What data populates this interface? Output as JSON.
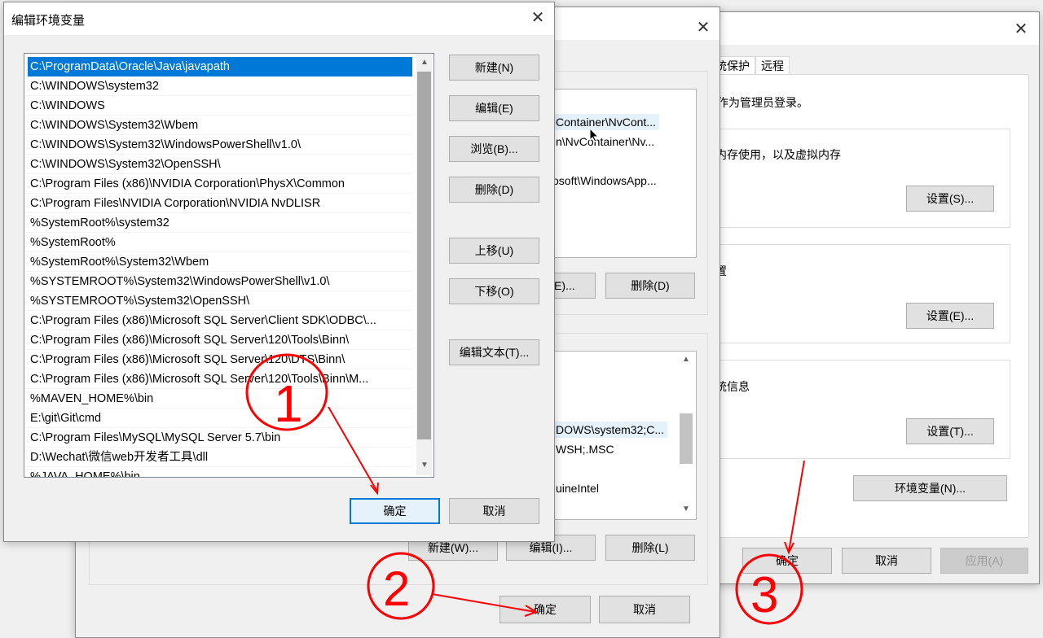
{
  "system_properties": {
    "tabs_partial": [
      "统保护",
      "远程"
    ],
    "admin_note": "作为管理员登录。",
    "perf_text": "内存使用，以及虚拟内存",
    "profile_text": "置",
    "startup_text": "统信息",
    "settings_labels": [
      "设置(S)...",
      "设置(E)...",
      "设置(T)..."
    ],
    "env_button": "环境变量(N)...",
    "ok": "确定",
    "cancel": "取消",
    "apply": "应用(A)"
  },
  "env_vars_window": {
    "user_vars_partial": [
      "Container\\NvCont...",
      "n\\NvContainer\\Nv...",
      "osoft\\WindowsApp..."
    ],
    "user_buttons": [
      "E)...",
      "删除(D)"
    ],
    "sys_vars_partial": [
      "DOWS\\system32;C...",
      "WSH;.MSC",
      "uineIntel"
    ],
    "sys_buttons": [
      "新建(W)...",
      "编辑(I)...",
      "删除(L)"
    ],
    "ok": "确定",
    "cancel": "取消"
  },
  "edit_dialog": {
    "title": "编辑环境变量",
    "entries": [
      "C:\\ProgramData\\Oracle\\Java\\javapath",
      "C:\\WINDOWS\\system32",
      "C:\\WINDOWS",
      "C:\\WINDOWS\\System32\\Wbem",
      "C:\\WINDOWS\\System32\\WindowsPowerShell\\v1.0\\",
      "C:\\WINDOWS\\System32\\OpenSSH\\",
      "C:\\Program Files (x86)\\NVIDIA Corporation\\PhysX\\Common",
      "C:\\Program Files\\NVIDIA Corporation\\NVIDIA NvDLISR",
      "%SystemRoot%\\system32",
      "%SystemRoot%",
      "%SystemRoot%\\System32\\Wbem",
      "%SYSTEMROOT%\\System32\\WindowsPowerShell\\v1.0\\",
      "%SYSTEMROOT%\\System32\\OpenSSH\\",
      "C:\\Program Files (x86)\\Microsoft SQL Server\\Client SDK\\ODBC\\...",
      "C:\\Program Files (x86)\\Microsoft SQL Server\\120\\Tools\\Binn\\",
      "C:\\Program Files (x86)\\Microsoft SQL Server\\120\\DTS\\Binn\\",
      "C:\\Program Files (x86)\\Microsoft SQL Server\\120\\Tools\\Binn\\M...",
      "%MAVEN_HOME%\\bin",
      "E:\\git\\Git\\cmd",
      "C:\\Program Files\\MySQL\\MySQL Server 5.7\\bin",
      "D:\\Wechat\\微信web开发者工具\\dll",
      "%JAVA_HOME%\\bin"
    ],
    "buttons": {
      "new": "新建(N)",
      "edit": "编辑(E)",
      "browse": "浏览(B)...",
      "delete": "删除(D)",
      "move_up": "上移(U)",
      "move_down": "下移(O)",
      "edit_text": "编辑文本(T)..."
    },
    "ok": "确定",
    "cancel": "取消"
  },
  "annotations": [
    "1",
    "2",
    "3"
  ],
  "colors": {
    "selection": "#0078d7",
    "annotation": "#ff0000"
  },
  "icons": [
    "close-icon",
    "scroll-up-icon",
    "scroll-down-icon",
    "cursor-icon"
  ]
}
